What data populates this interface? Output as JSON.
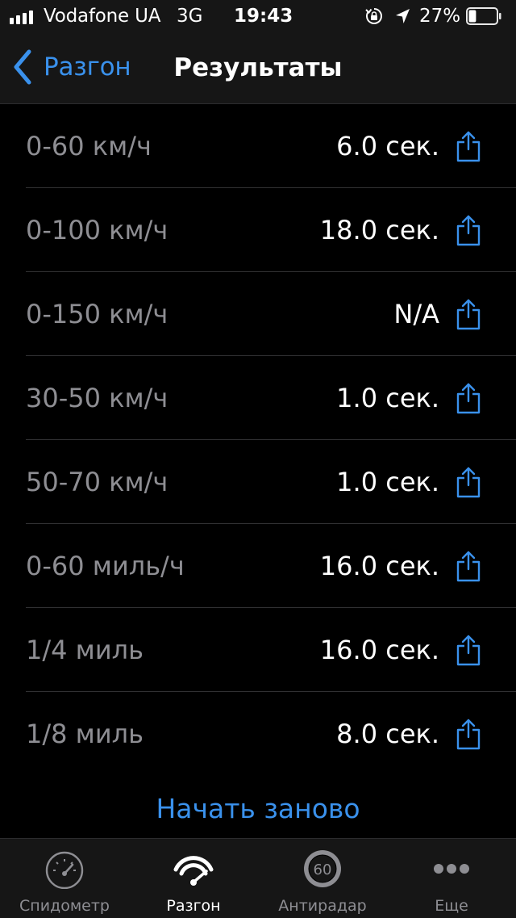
{
  "status_bar": {
    "carrier": "Vodafone UA",
    "network": "3G",
    "time": "19:43",
    "battery_percent": "27%",
    "battery_level": 0.27
  },
  "nav": {
    "back_label": "Разгон",
    "title": "Результаты"
  },
  "results": [
    {
      "label": "0-60 км/ч",
      "value": "6.0 сек."
    },
    {
      "label": "0-100 км/ч",
      "value": "18.0 сек."
    },
    {
      "label": "0-150 км/ч",
      "value": "N/A"
    },
    {
      "label": "30-50 км/ч",
      "value": "1.0 сек."
    },
    {
      "label": "50-70 км/ч",
      "value": "1.0 сек."
    },
    {
      "label": "0-60 миль/ч",
      "value": "16.0 сек."
    },
    {
      "label": "1/4 миль",
      "value": "16.0 сек."
    },
    {
      "label": "1/8 миль",
      "value": "8.0 сек."
    }
  ],
  "restart_label": "Начать заново",
  "tabs": [
    {
      "label": "Спидометр",
      "icon": "speedometer-icon",
      "active": false
    },
    {
      "label": "Разгон",
      "icon": "acceleration-icon",
      "active": true
    },
    {
      "label": "Антирадар",
      "icon": "speed-limit-icon",
      "active": false,
      "icon_text": "60"
    },
    {
      "label": "Еще",
      "icon": "more-icon",
      "active": false
    }
  ],
  "colors": {
    "accent": "#3a91ec",
    "background": "#000000",
    "bar_background": "#161616",
    "secondary_text": "#8e8e93"
  }
}
